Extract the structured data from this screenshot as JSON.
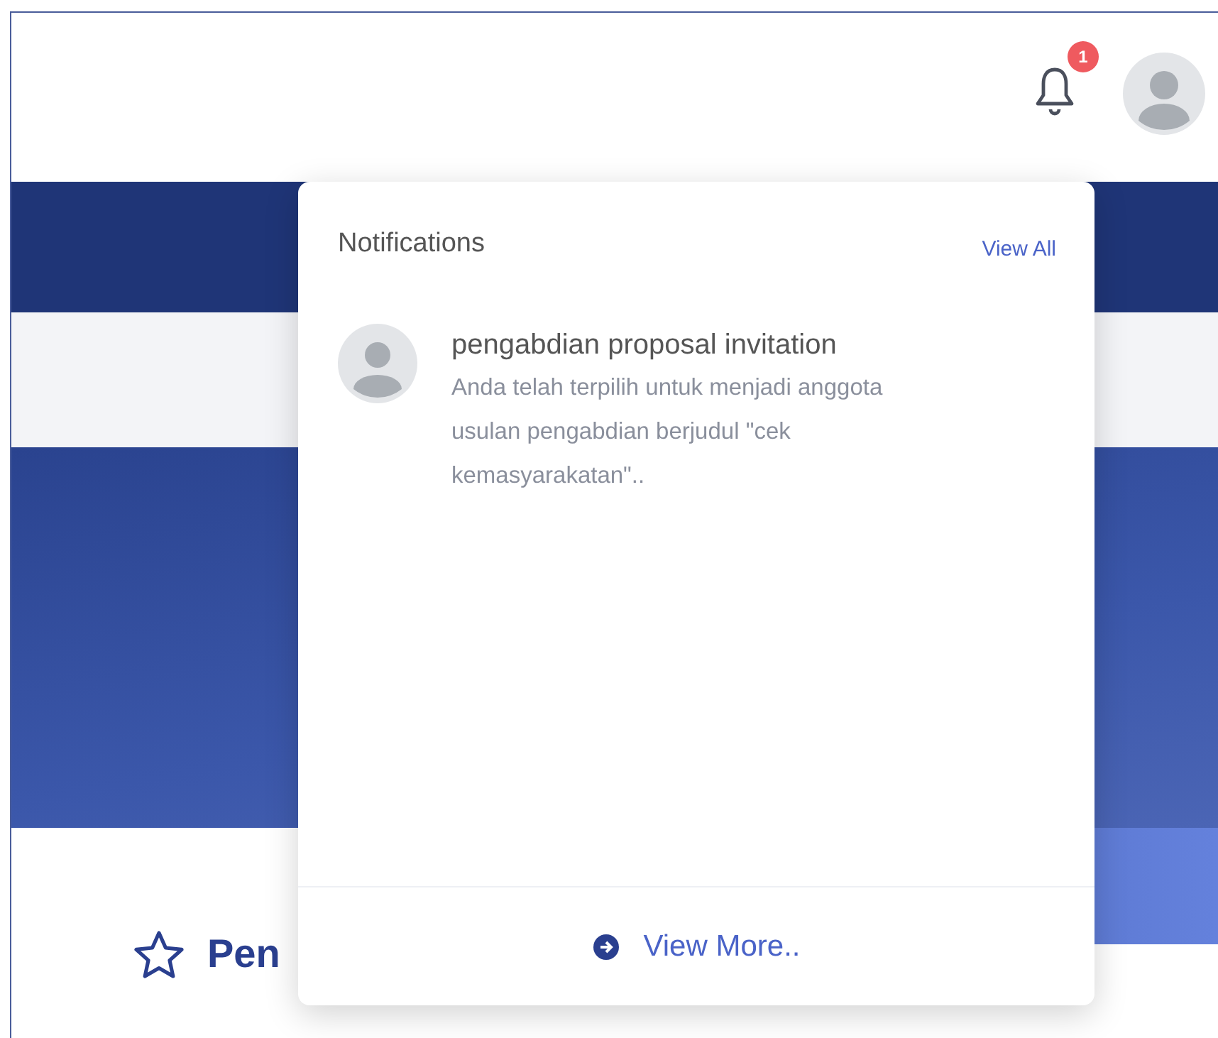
{
  "header": {
    "notification_count": "1"
  },
  "notifications": {
    "title": "Notifications",
    "view_all": "View All",
    "items": [
      {
        "title": "pengabdian proposal invitation",
        "message": "Anda telah terpilih untuk menjadi anggota usulan pengabdian berjudul \"cek kemasyarakatan\".."
      }
    ],
    "view_more": "View More.."
  },
  "section": {
    "title": "Pen"
  }
}
